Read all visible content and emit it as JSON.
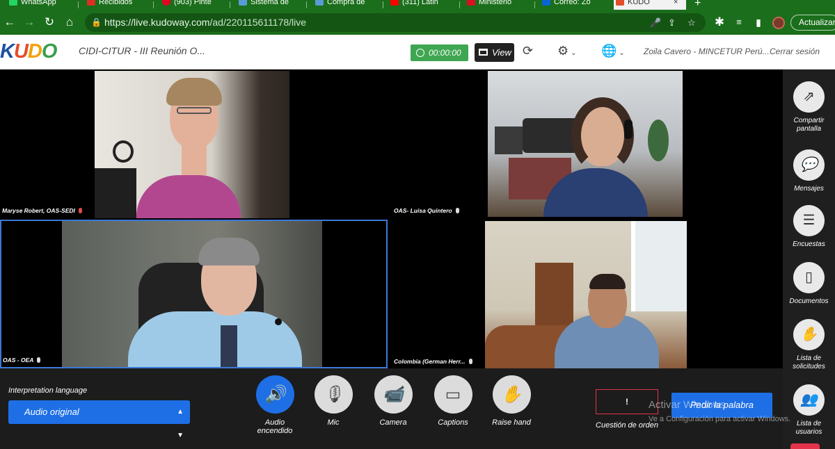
{
  "browser": {
    "tabs": [
      {
        "label": "WhatsApp",
        "fav": "#25d366"
      },
      {
        "label": "Recibidos",
        "fav": "#d93025"
      },
      {
        "label": "(903) Pinte",
        "fav": "#e60023"
      },
      {
        "label": "Sistema de",
        "fav": "#5b9bd5"
      },
      {
        "label": "Compra de",
        "fav": "#5b9bd5"
      },
      {
        "label": "(311) Latin",
        "fav": "#ff0000"
      },
      {
        "label": "Ministerio",
        "fav": "#d91023"
      },
      {
        "label": "Correo: Zo",
        "fav": "#0a64d6"
      },
      {
        "label": "KUDO",
        "fav": "#e34d2a"
      }
    ],
    "url_host": "https://live.kudoway.com",
    "url_path": "/ad/220115611178/live",
    "update_label": "Actualizar"
  },
  "header": {
    "logo": {
      "k": "K",
      "u": "U",
      "d": "D",
      "o": "O"
    },
    "event_title": "CIDI-CITUR - III Reunión O...",
    "timer": "00:00:00",
    "view_label": "View",
    "user": "Zoila Cavero - MINCETUR Perú...",
    "logout": "Cerrar sesión"
  },
  "participants": [
    {
      "name": "Maryse Robert, OAS-SEDI",
      "mic": "muted"
    },
    {
      "name": "OAS- Luisa Quintero",
      "mic": "on"
    },
    {
      "name": "OAS - OEA",
      "mic": "on"
    },
    {
      "name": "Colombia (German Herr...",
      "mic": "on"
    }
  ],
  "sidebar": {
    "share": "Compartir pantalla",
    "messages": "Mensajes",
    "polls": "Encuestas",
    "documents": "Documentos",
    "requests": "Lista de solicitudes",
    "users": "Lista de usuarios"
  },
  "controls": {
    "interp_label": "Interpretation language",
    "interp_value": "Audio original",
    "audio": "Audio encendido",
    "mic": "Mic",
    "camera": "Camera",
    "captions": "Captions",
    "raise_hand": "Raise hand",
    "point_symbol": "!",
    "point_label": "Cuestión de orden",
    "request_floor": "Pedir la palabra"
  },
  "watermark": {
    "line1": "Activar Windows",
    "line2": "Ve a Configuración para activar Windows."
  }
}
